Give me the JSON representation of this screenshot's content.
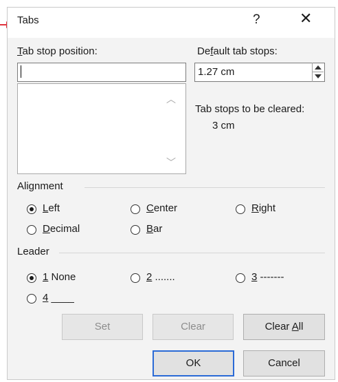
{
  "window": {
    "title": "Tabs",
    "help_label": "?",
    "close_label": "✕"
  },
  "tab_stop": {
    "label_first": "T",
    "label_rest": "ab stop position:",
    "value": ""
  },
  "default_tab_stops": {
    "label_pre": "De",
    "label_underlined": "f",
    "label_post": "ault tab stops:",
    "value": "1.27 cm"
  },
  "cleared": {
    "label": "Tab stops to be cleared:",
    "value": "3 cm"
  },
  "alignment": {
    "title": "Alignment",
    "options": [
      {
        "key": "L",
        "rest": "eft",
        "selected": true
      },
      {
        "key": "C",
        "rest": "enter",
        "selected": false
      },
      {
        "key": "R",
        "rest": "ight",
        "selected": false
      },
      {
        "key": "D",
        "rest": "ecimal",
        "selected": false
      },
      {
        "key": "B",
        "rest": "ar",
        "selected": false
      }
    ]
  },
  "leader": {
    "title": "Leader",
    "options": [
      {
        "key": "1",
        "rest": " None",
        "selected": true
      },
      {
        "key": "2",
        "rest": " .......",
        "selected": false
      },
      {
        "key": "3",
        "rest": " -------",
        "selected": false
      },
      {
        "key": "4",
        "rest": " ____",
        "selected": false
      }
    ]
  },
  "buttons": {
    "set": "Set",
    "clear": "Clear",
    "clear_all_pre": "Clear ",
    "clear_all_key": "A",
    "clear_all_post": "ll",
    "ok": "OK",
    "cancel": "Cancel"
  },
  "colors": {
    "pointer_arrow": "#e0303a",
    "default_button_border": "#2a6ad6"
  }
}
